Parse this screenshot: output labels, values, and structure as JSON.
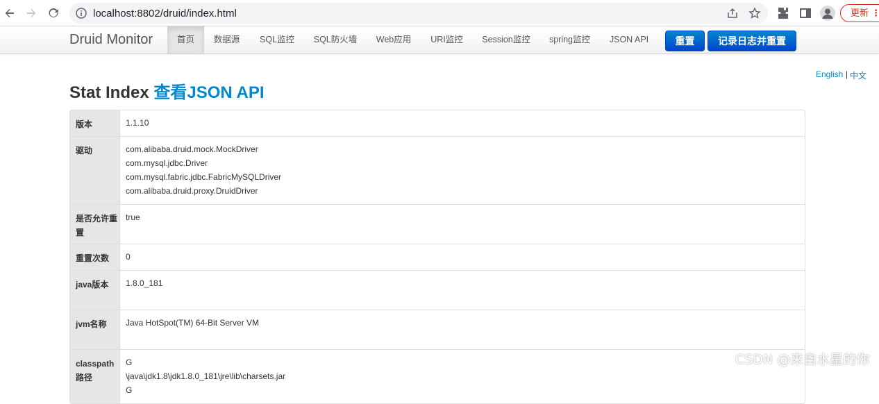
{
  "browser": {
    "url": "localhost:8802/druid/index.html",
    "update_label": "更新"
  },
  "navbar": {
    "brand": "Druid Monitor",
    "items": [
      "首页",
      "数据源",
      "SQL监控",
      "SQL防火墙",
      "Web应用",
      "URI监控",
      "Session监控",
      "spring监控",
      "JSON API"
    ],
    "active_index": 0,
    "reset_label": "重置",
    "log_reset_label": "记录日志并重置"
  },
  "lang": {
    "english": "English",
    "sep": "|",
    "chinese": "中文"
  },
  "page": {
    "title": "Stat Index",
    "json_link": "查看JSON API"
  },
  "table": {
    "rows": [
      {
        "label": "版本",
        "values": [
          "1.1.10"
        ]
      },
      {
        "label": "驱动",
        "values": [
          "com.alibaba.druid.mock.MockDriver",
          "com.mysql.jdbc.Driver",
          "com.mysql.fabric.jdbc.FabricMySQLDriver",
          "com.alibaba.druid.proxy.DruidDriver"
        ]
      },
      {
        "label": "是否允许重置",
        "values": [
          "true"
        ]
      },
      {
        "label": "重置次数",
        "values": [
          "0"
        ]
      },
      {
        "label": "java版本",
        "values": [
          "1.8.0_181"
        ]
      },
      {
        "label": "jvm名称",
        "values": [
          "Java HotSpot(TM) 64-Bit Server VM"
        ]
      },
      {
        "label": "classpath路径",
        "values": [
          "G",
          "\\java\\jdk1.8\\jdk1.8.0_181\\jre\\lib\\charsets.jar",
          "G"
        ]
      }
    ]
  },
  "watermark": "CSDN @来自水星的你",
  "colors": {
    "link": "#0088cc",
    "button_primary": "#0044cc",
    "update_red": "#d93025"
  }
}
